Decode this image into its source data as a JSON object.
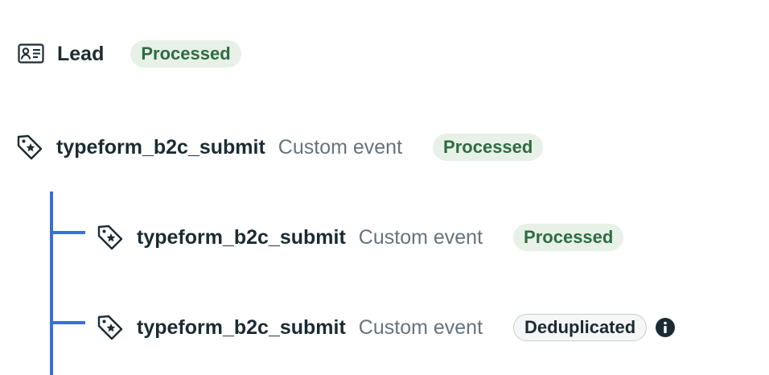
{
  "lead": {
    "icon": "contact-card-icon",
    "label": "Lead",
    "status": "Processed"
  },
  "parent_event": {
    "icon": "tag-icon",
    "name": "typeform_b2c_submit",
    "type": "Custom event",
    "status": "Processed"
  },
  "child_events": [
    {
      "icon": "tag-icon",
      "name": "typeform_b2c_submit",
      "type": "Custom event",
      "status": "Processed"
    },
    {
      "icon": "tag-icon",
      "name": "typeform_b2c_submit",
      "type": "Custom event",
      "status": "Deduplicated",
      "status_info_icon": "info-icon"
    }
  ],
  "colors": {
    "processed_bg": "#e7f1e8",
    "processed_text": "#2e6b43",
    "dedup_bg": "#f5f6f7",
    "tree_line": "#3b6fd8"
  }
}
